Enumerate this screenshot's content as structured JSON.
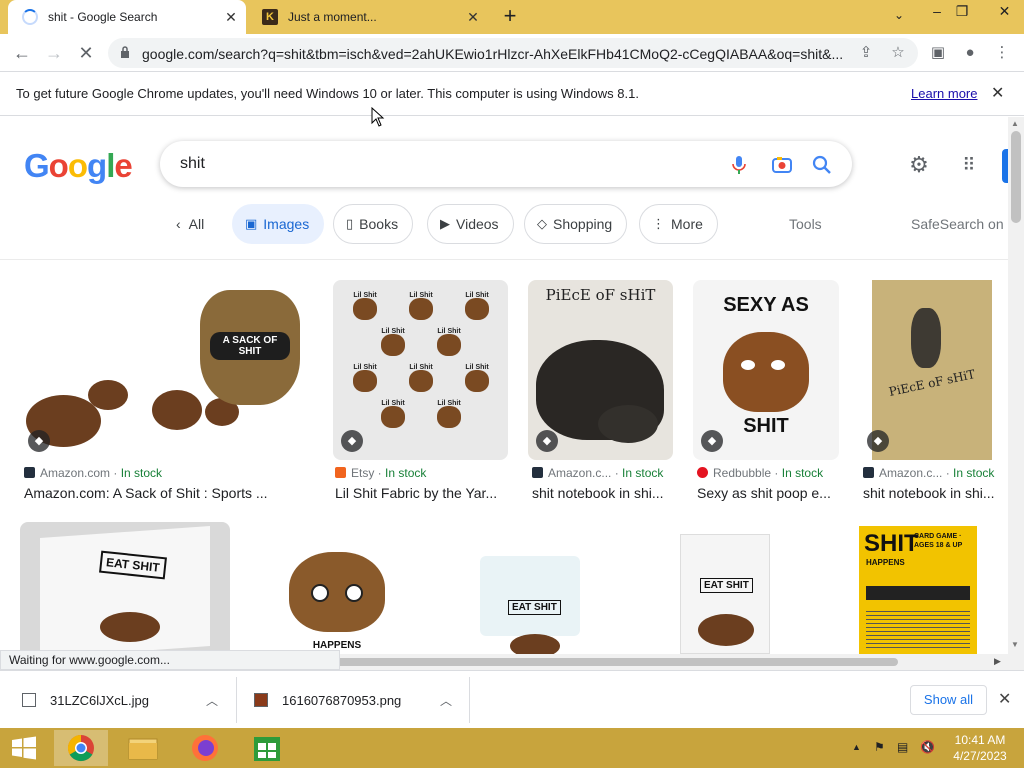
{
  "browser": {
    "tabs": [
      {
        "title": "shit - Google Search",
        "active": true
      },
      {
        "title": "Just a moment...",
        "active": false
      }
    ],
    "url": "google.com/search?q=shit&tbm=isch&ved=2ahUKEwio1rHlzcr-AhXeElkFHb41CMoQ2-cCegQIABAA&oq=shit&...",
    "infobar": {
      "message": "To get future Google Chrome updates, you'll need Windows 10 or later. This computer is using Windows 8.1.",
      "link": "Learn more"
    },
    "status": "Waiting for www.google.com..."
  },
  "search": {
    "logo": "Google",
    "query": "shit",
    "chips": [
      {
        "label": "All"
      },
      {
        "label": "Images"
      },
      {
        "label": "Books"
      },
      {
        "label": "Videos"
      },
      {
        "label": "Shopping"
      },
      {
        "label": "More"
      }
    ],
    "tools": "Tools",
    "safesearch": "SafeSearch on"
  },
  "results": [
    {
      "source": "Amazon.com",
      "stock": "In stock",
      "caption": "Amazon.com: A Sack of Shit : Sports ..."
    },
    {
      "source": "Etsy",
      "stock": "In stock",
      "caption": "Lil Shit Fabric by the Yar..."
    },
    {
      "source": "Amazon.c...",
      "stock": "In stock",
      "caption": "shit notebook in shi..."
    },
    {
      "source": "Redbubble",
      "stock": "In stock",
      "caption": "Sexy as shit poop e..."
    },
    {
      "source": "Amazon.c...",
      "stock": "In stock",
      "caption": "shit notebook in shi..."
    }
  ],
  "image_text": {
    "sack": "A SACK OF SHIT",
    "lil": "Lil Shit",
    "piece": "PiEcE oF sHiT",
    "sexy_top": "SEXY AS",
    "sexy_bottom": "SHIT",
    "eat": "EAT SHIT",
    "card_title": "SHIT",
    "card_sub": "CARD GAME · AGES 18 & UP",
    "card_happens": "HAPPENS",
    "happens": "HAPPENS"
  },
  "downloads": [
    {
      "name": "31LZC6lJXcL.jpg"
    },
    {
      "name": "1616076870953.png"
    }
  ],
  "shelf": {
    "show_all": "Show all"
  },
  "taskbar": {
    "time": "10:41 AM",
    "date": "4/27/2023"
  }
}
